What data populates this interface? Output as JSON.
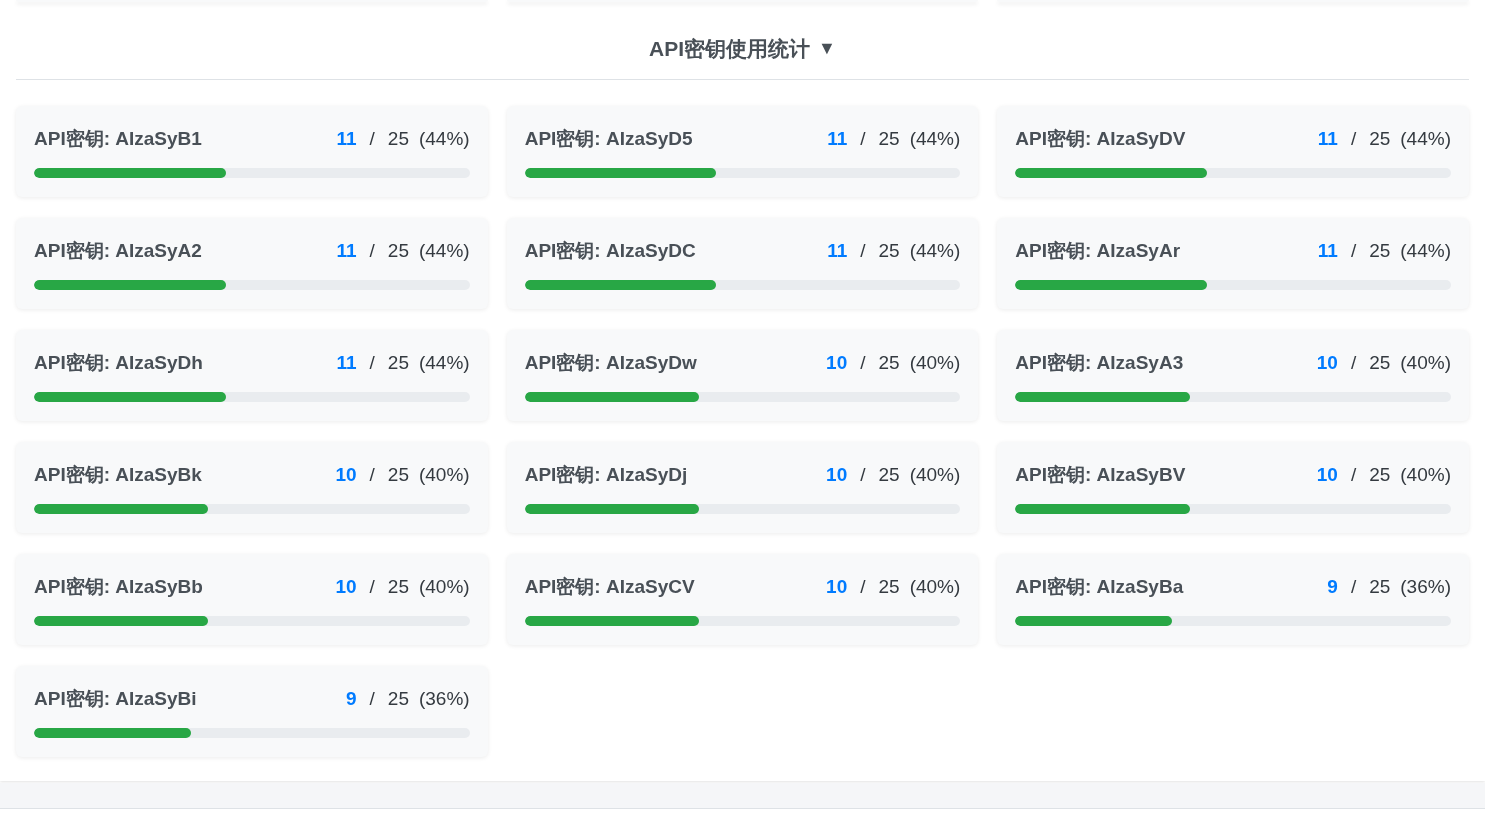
{
  "title": "API密钥使用统计",
  "toggle": "▼",
  "keys": [
    {
      "name": "API密钥: AIzaSyB1",
      "used": "11",
      "sep": "/",
      "total": "25",
      "percent": "(44%)",
      "level": 0.44
    },
    {
      "name": "API密钥: AIzaSyD5",
      "used": "11",
      "sep": "/",
      "total": "25",
      "percent": "(44%)",
      "level": 0.44
    },
    {
      "name": "API密钥: AIzaSyDV",
      "used": "11",
      "sep": "/",
      "total": "25",
      "percent": "(44%)",
      "level": 0.44
    },
    {
      "name": "API密钥: AIzaSyA2",
      "used": "11",
      "sep": "/",
      "total": "25",
      "percent": "(44%)",
      "level": 0.44
    },
    {
      "name": "API密钥: AIzaSyDC",
      "used": "11",
      "sep": "/",
      "total": "25",
      "percent": "(44%)",
      "level": 0.44
    },
    {
      "name": "API密钥: AIzaSyAr",
      "used": "11",
      "sep": "/",
      "total": "25",
      "percent": "(44%)",
      "level": 0.44
    },
    {
      "name": "API密钥: AIzaSyDh",
      "used": "11",
      "sep": "/",
      "total": "25",
      "percent": "(44%)",
      "level": 0.44
    },
    {
      "name": "API密钥: AIzaSyDw",
      "used": "10",
      "sep": "/",
      "total": "25",
      "percent": "(40%)",
      "level": 0.4
    },
    {
      "name": "API密钥: AIzaSyA3",
      "used": "10",
      "sep": "/",
      "total": "25",
      "percent": "(40%)",
      "level": 0.4
    },
    {
      "name": "API密钥: AIzaSyBk",
      "used": "10",
      "sep": "/",
      "total": "25",
      "percent": "(40%)",
      "level": 0.4
    },
    {
      "name": "API密钥: AIzaSyDj",
      "used": "10",
      "sep": "/",
      "total": "25",
      "percent": "(40%)",
      "level": 0.4
    },
    {
      "name": "API密钥: AIzaSyBV",
      "used": "10",
      "sep": "/",
      "total": "25",
      "percent": "(40%)",
      "level": 0.4
    },
    {
      "name": "API密钥: AIzaSyBb",
      "used": "10",
      "sep": "/",
      "total": "25",
      "percent": "(40%)",
      "level": 0.4
    },
    {
      "name": "API密钥: AIzaSyCV",
      "used": "10",
      "sep": "/",
      "total": "25",
      "percent": "(40%)",
      "level": 0.4
    },
    {
      "name": "API密钥: AIzaSyBa",
      "used": "9",
      "sep": "/",
      "total": "25",
      "percent": "(36%)",
      "level": 0.36
    },
    {
      "name": "API密钥: AIzaSyBi",
      "used": "9",
      "sep": "/",
      "total": "25",
      "percent": "(36%)",
      "level": 0.36
    }
  ]
}
